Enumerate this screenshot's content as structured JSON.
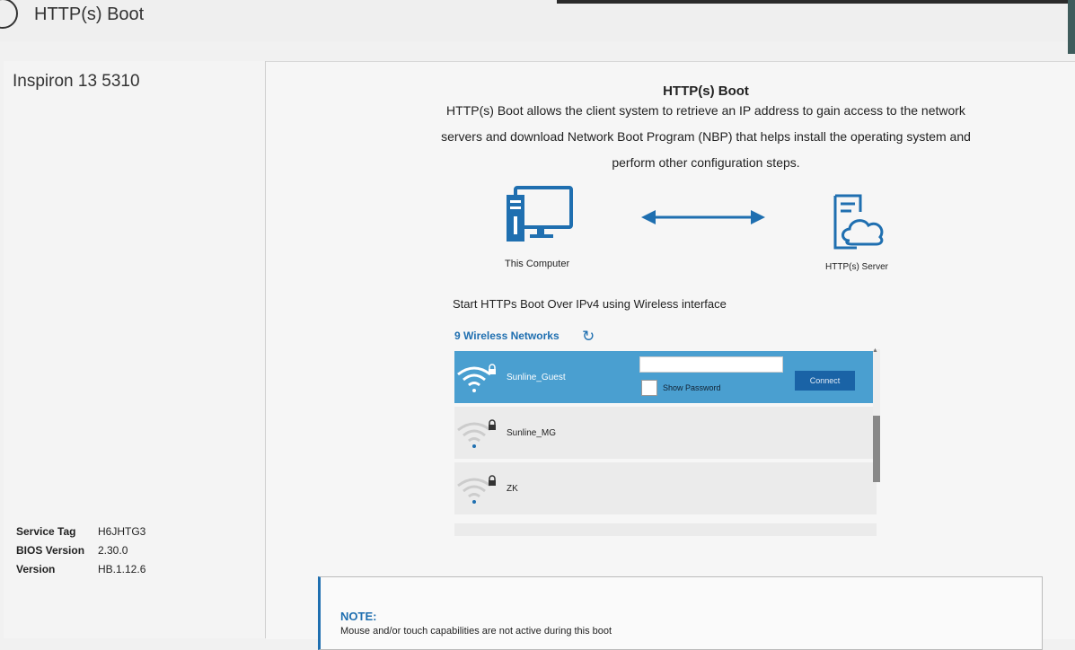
{
  "header": {
    "title": "HTTP(s) Boot"
  },
  "sidebar": {
    "model": "Inspiron 13 5310",
    "info": [
      {
        "label": "Service Tag",
        "value": "H6JHTG3"
      },
      {
        "label": "BIOS Version",
        "value": "2.30.0"
      },
      {
        "label": "Version",
        "value": "HB.1.12.6"
      }
    ]
  },
  "main": {
    "heading": "HTTP(s) Boot",
    "description": "HTTP(s) Boot allows the client system to retrieve an IP address to gain access to the network servers and download Network Boot Program (NBP) that helps install the operating system and perform other configuration steps.",
    "computer_label": "This Computer",
    "server_label": "HTTP(s) Server",
    "start_text": "Start HTTPs Boot Over IPv4 using Wireless interface",
    "networks_count": "9 Wireless Networks",
    "networks": [
      {
        "name": "Sunline_Guest",
        "selected": true
      },
      {
        "name": "Sunline_MG",
        "selected": false
      },
      {
        "name": "ZK",
        "selected": false
      }
    ],
    "password_value": "",
    "show_password_label": "Show Password",
    "connect_label": "Connect",
    "accent_color": "#1f6fb0",
    "selected_row_color": "#4a9fd0"
  },
  "note": {
    "title": "NOTE:",
    "text": "Mouse and/or touch capabilities are not active during this boot"
  }
}
